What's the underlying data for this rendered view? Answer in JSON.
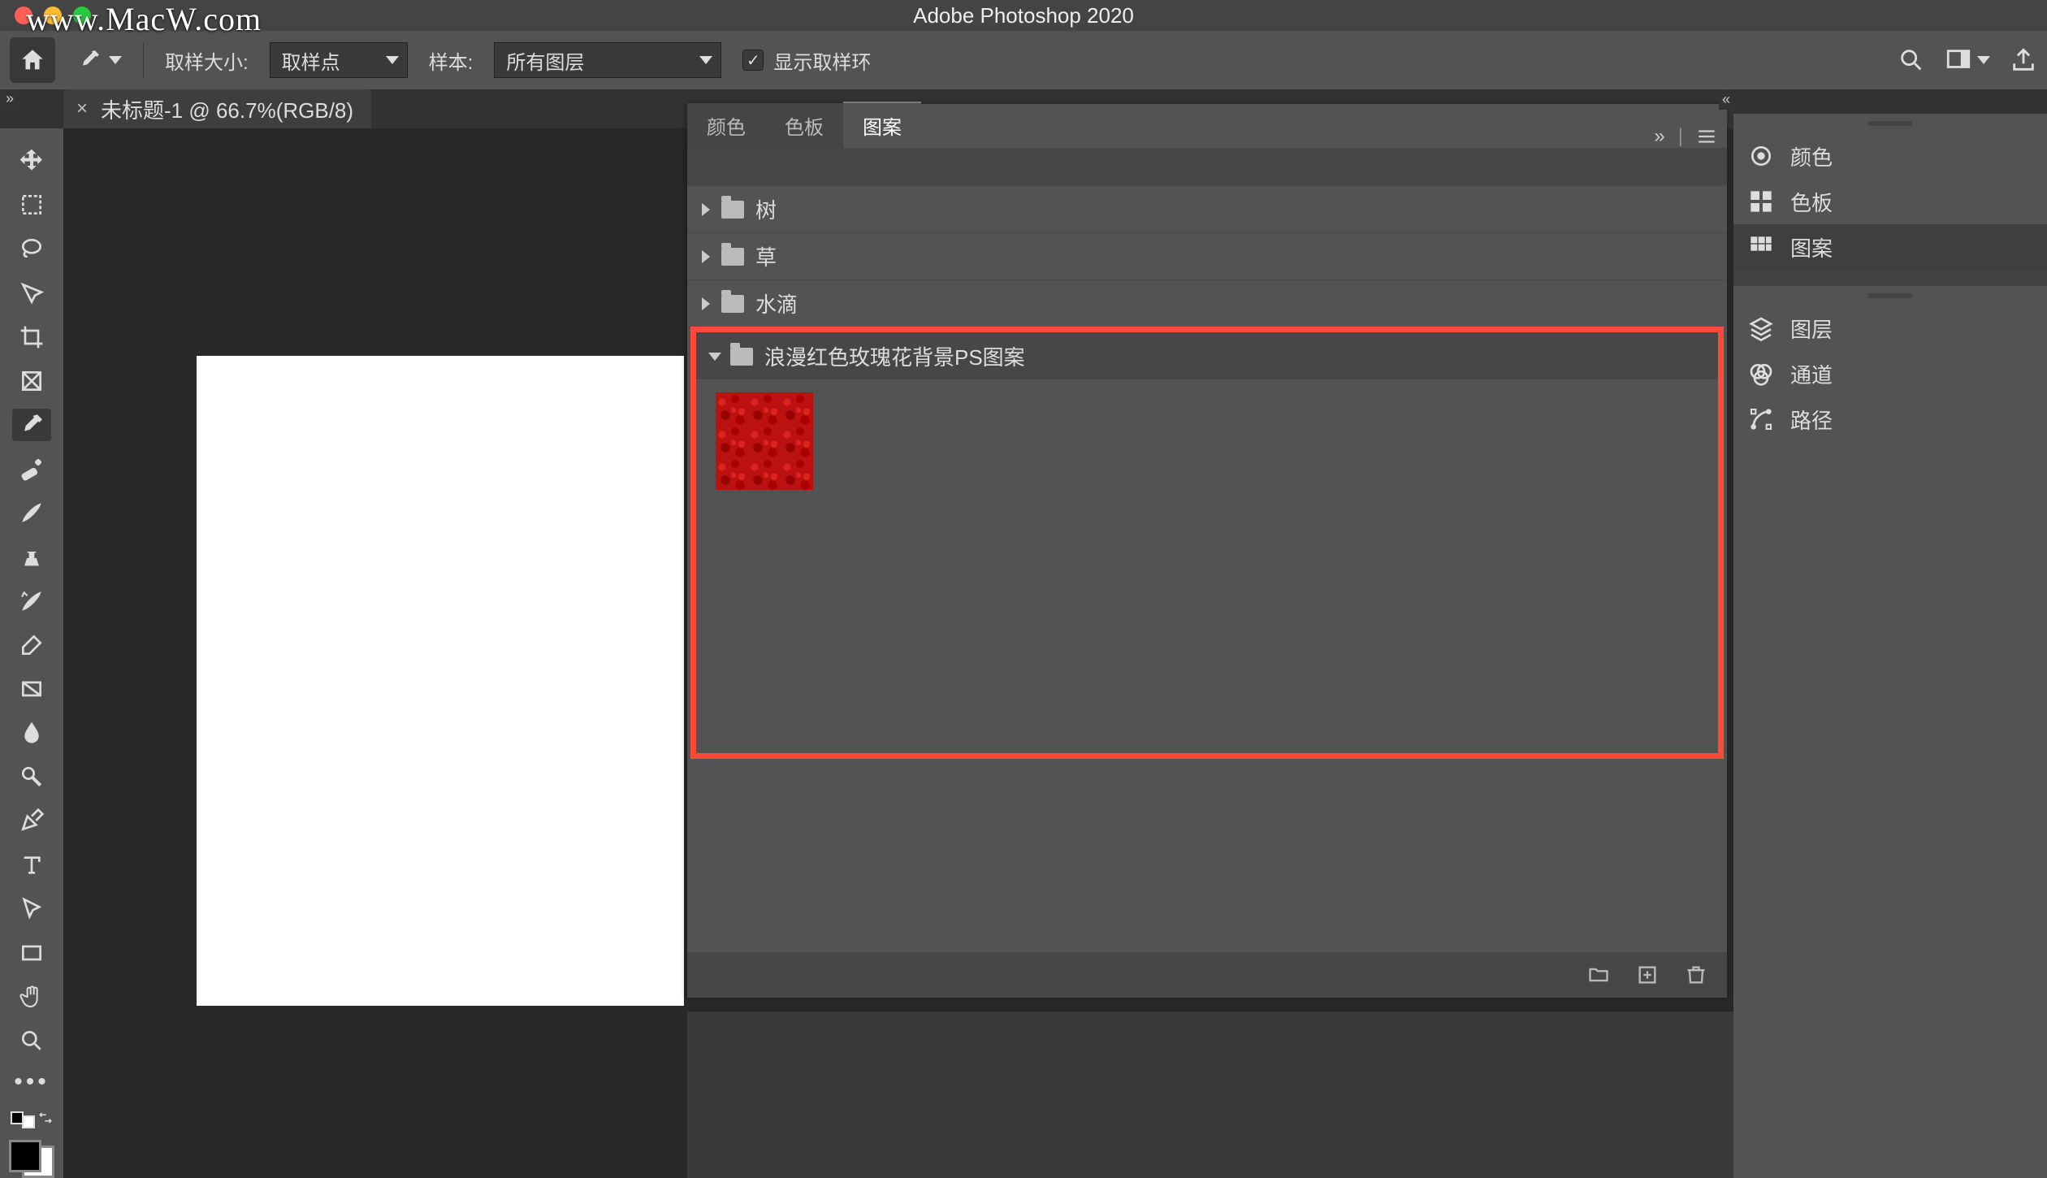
{
  "watermark": "www.MacW.com",
  "app_title": "Adobe Photoshop 2020",
  "options": {
    "sample_size_label": "取样大小:",
    "sample_size_value": "取样点",
    "sample_label": "样本:",
    "sample_value": "所有图层",
    "show_ring_label": "显示取样环"
  },
  "doc_tab": "未标题-1 @ 66.7%(RGB/8)",
  "panel": {
    "tabs": {
      "color": "颜色",
      "swatches": "色板",
      "patterns": "图案"
    },
    "folders": {
      "tree": "树",
      "grass": "草",
      "water": "水滴",
      "rose": "浪漫红色玫瑰花背景PS图案"
    }
  },
  "rside": {
    "color": "颜色",
    "swatches": "色板",
    "patterns": "图案",
    "layers": "图层",
    "channels": "通道",
    "paths": "路径"
  }
}
